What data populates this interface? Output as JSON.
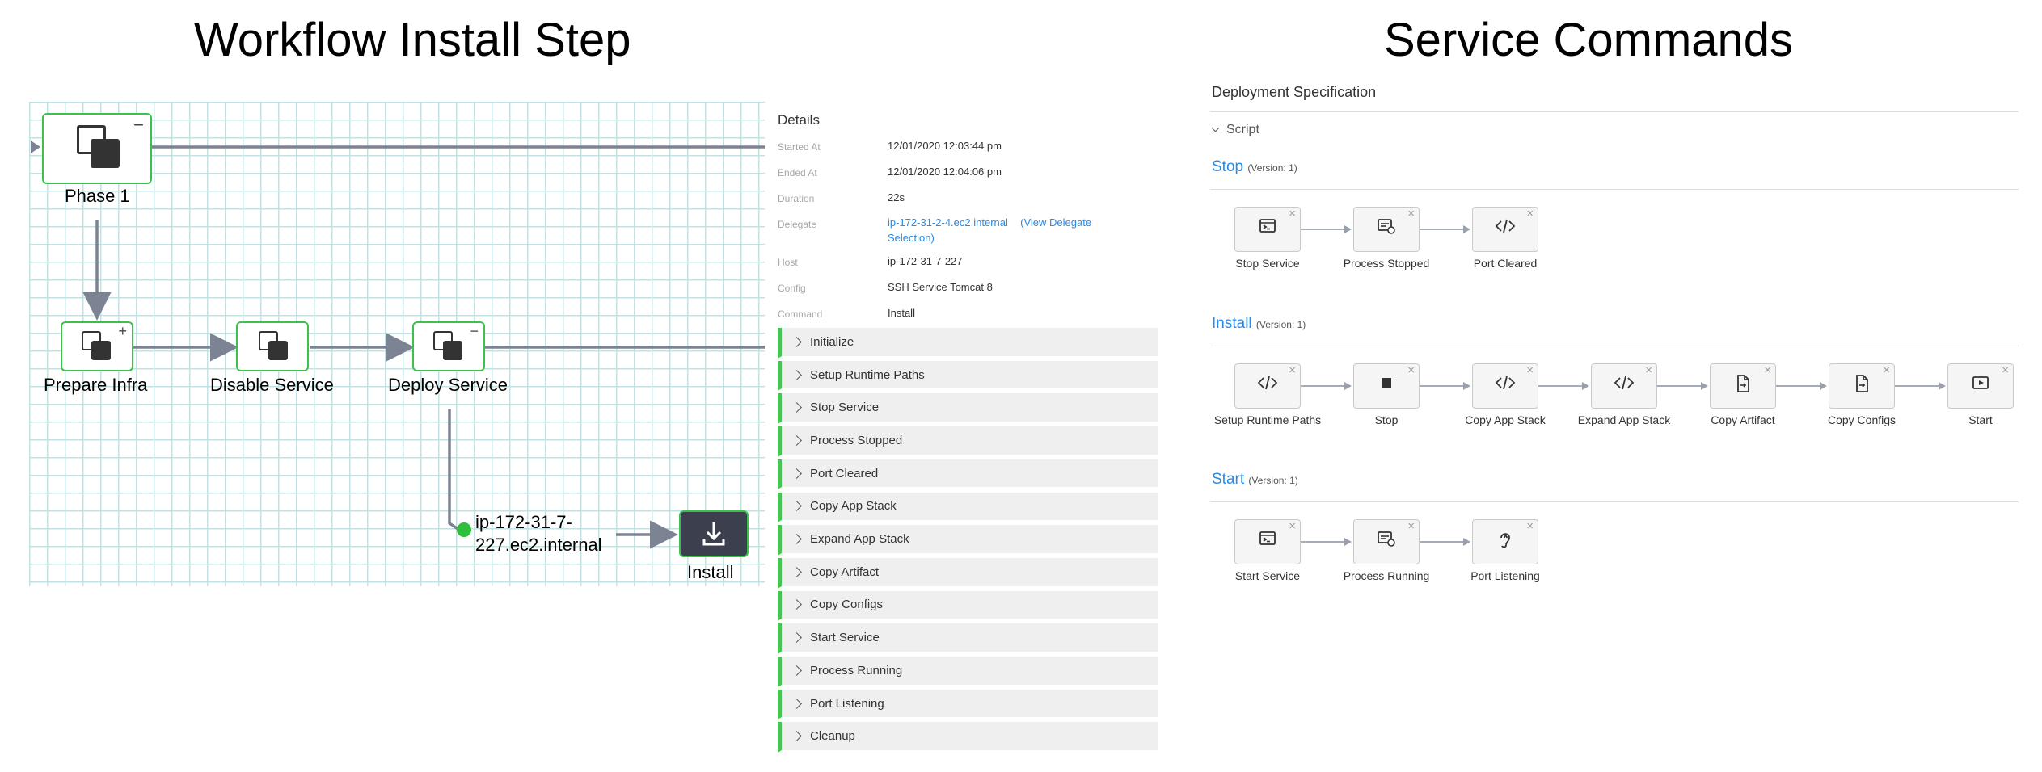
{
  "left_title": "Workflow Install Step",
  "right_title": "Service Commands",
  "workflow": {
    "phase_label": "Phase 1",
    "phase_toggle": "−",
    "prepare_label": "Prepare Infra",
    "prepare_toggle": "+",
    "disable_label": "Disable Service",
    "deploy_label": "Deploy Service",
    "deploy_toggle": "−",
    "host_label_line1": "ip-172-31-7-",
    "host_label_line2": "227.ec2.internal",
    "install_label": "Install",
    "colors": {
      "node_border": "#3cc14c",
      "edge": "#7c8494",
      "install_bg": "#3b3f4e",
      "status_dot": "#2fbf3c"
    }
  },
  "details": {
    "title": "Details",
    "started_at_label": "Started At",
    "started_at": "12/01/2020 12:03:44 pm",
    "ended_at_label": "Ended At",
    "ended_at": "12/01/2020 12:04:06 pm",
    "duration_label": "Duration",
    "duration": "22s",
    "delegate_label": "Delegate",
    "delegate_host": "ip-172-31-2-4.ec2.internal",
    "delegate_link_1": "(View Delegate",
    "delegate_link_2": "Selection)",
    "host_label": "Host",
    "host": "ip-172-31-7-227",
    "config_label": "Config",
    "config": "SSH Service Tomcat 8",
    "command_label": "Command",
    "command": "Install",
    "steps": [
      "Initialize",
      "Setup Runtime Paths",
      "Stop Service",
      "Process Stopped",
      "Port Cleared",
      "Copy App Stack",
      "Expand App Stack",
      "Copy Artifact",
      "Copy Configs",
      "Start Service",
      "Process Running",
      "Port Listening",
      "Cleanup"
    ]
  },
  "service": {
    "header": "Deployment Specification",
    "script_label": "Script",
    "sections": [
      {
        "name": "Stop",
        "version": "(Version: 1)",
        "commands": [
          {
            "label": "Stop Service",
            "icon": "terminal-icon"
          },
          {
            "label": "Process Stopped",
            "icon": "process-icon"
          },
          {
            "label": "Port Cleared",
            "icon": "code-icon"
          }
        ]
      },
      {
        "name": "Install",
        "version": "(Version: 1)",
        "commands": [
          {
            "label": "Setup Runtime Paths",
            "icon": "code-icon"
          },
          {
            "label": "Stop",
            "icon": "stop-icon"
          },
          {
            "label": "Copy App Stack",
            "icon": "code-icon"
          },
          {
            "label": "Expand App Stack",
            "icon": "code-icon"
          },
          {
            "label": "Copy Artifact",
            "icon": "file-icon"
          },
          {
            "label": "Copy Configs",
            "icon": "file-icon"
          },
          {
            "label": "Start",
            "icon": "play-icon"
          }
        ]
      },
      {
        "name": "Start",
        "version": "(Version: 1)",
        "commands": [
          {
            "label": "Start Service",
            "icon": "terminal-icon"
          },
          {
            "label": "Process Running",
            "icon": "process-icon"
          },
          {
            "label": "Port Listening",
            "icon": "ear-icon"
          }
        ]
      }
    ],
    "close_glyph": "×"
  }
}
